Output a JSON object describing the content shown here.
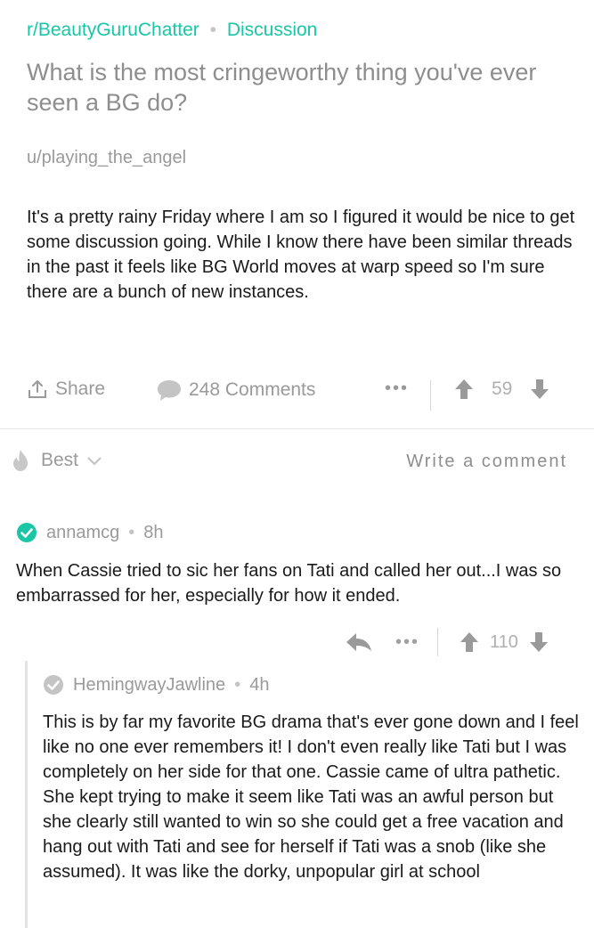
{
  "post": {
    "subreddit": "r/BeautyGuruChatter",
    "separator": "•",
    "flair": "Discussion",
    "title": "What is the most cringeworthy thing you've ever seen a BG do?",
    "author": "u/playing_the_angel",
    "body": "It's a pretty rainy Friday where I am so I figured it would be nice to get some discussion going. While I know there have been similar threads in the past it feels like BG World moves at warp speed so I'm sure there are a bunch of new instances.",
    "share_label": "Share",
    "comments_label": "248 Comments",
    "more_label": "•••",
    "score": "59"
  },
  "sort": {
    "label": "Best",
    "write_comment": "Write a comment"
  },
  "comments": [
    {
      "username": "annamcg",
      "separator": "•",
      "age": "8h",
      "body": "When Cassie tried to sic her fans on Tati and called her out...I was so embarrassed for her, especially for how it ended.",
      "more_label": "•••",
      "score": "110"
    },
    {
      "username": "HemingwayJawline",
      "separator": "•",
      "age": "4h",
      "body": "This is by far my favorite BG drama that's ever gone down and I feel like no one ever remembers it! I don't even really like Tati but I was completely on her side for that one. Cassie came of ultra pathetic. She kept trying to make it seem like Tati was an awful person but she clearly still wanted to win so she could get a free vacation and hang out with Tati and see for herself if Tati was a snob (like she assumed). It was like the dorky, unpopular girl at school"
    }
  ],
  "colors": {
    "accent": "#19c6a6",
    "muted": "#9a9a9a",
    "text": "#1a1a1b"
  },
  "icons": [
    "share-icon",
    "comment-bubble-icon",
    "upvote-icon",
    "downvote-icon",
    "flame-icon",
    "chevron-down-icon",
    "check-badge-icon",
    "reply-icon"
  ]
}
